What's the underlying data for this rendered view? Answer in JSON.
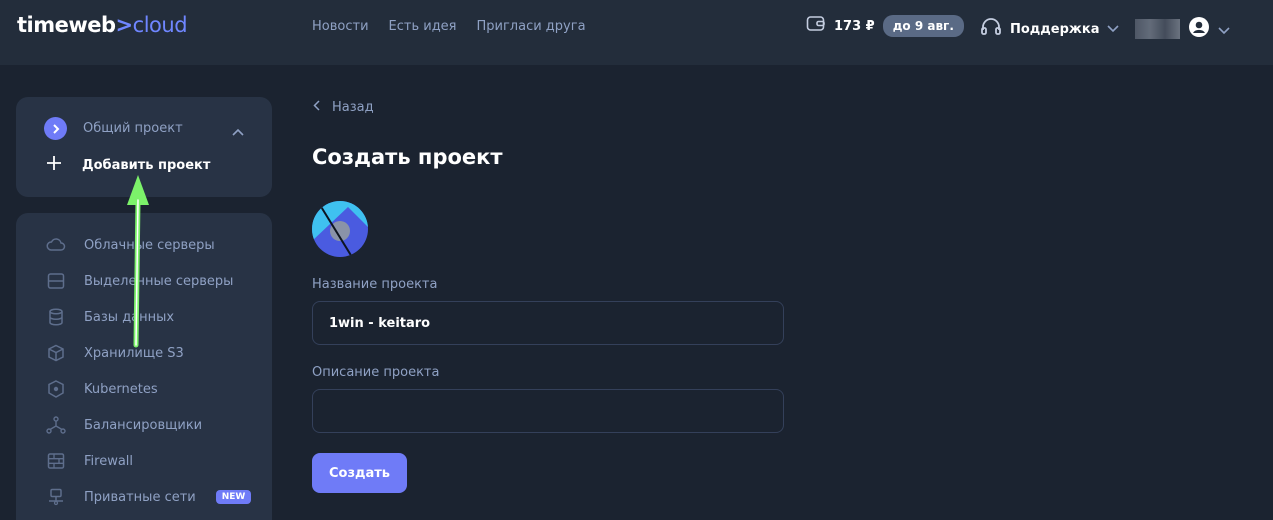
{
  "header": {
    "logo_main": "timeweb",
    "logo_chevron": ">",
    "logo_accent": "cloud",
    "nav": [
      "Новости",
      "Есть идея",
      "Пригласи друга"
    ],
    "balance": "173 ₽",
    "balance_until": "до 9 авг.",
    "support_label": "Поддержка"
  },
  "sidebar": {
    "project_name": "Общий проект",
    "add_project_label": "Добавить проект",
    "items": [
      {
        "label": "Облачные серверы",
        "icon": "cloud-icon"
      },
      {
        "label": "Выделенные серверы",
        "icon": "server-icon"
      },
      {
        "label": "Базы данных",
        "icon": "database-icon"
      },
      {
        "label": "Хранилище S3",
        "icon": "cube-icon"
      },
      {
        "label": "Kubernetes",
        "icon": "kubernetes-icon"
      },
      {
        "label": "Балансировщики",
        "icon": "balancer-icon"
      },
      {
        "label": "Firewall",
        "icon": "firewall-icon"
      },
      {
        "label": "Приватные сети",
        "icon": "network-icon",
        "badge": "NEW"
      }
    ]
  },
  "main": {
    "back_label": "Назад",
    "title": "Создать проект",
    "name_label": "Название проекта",
    "name_value": "1win - keitaro",
    "description_label": "Описание проекта",
    "description_value": "",
    "submit_label": "Создать"
  },
  "colors": {
    "background": "#1b2330",
    "header": "#232d3b",
    "panel": "#283345",
    "accent": "#6f7bf7",
    "muted_text": "#8fa1c4",
    "arrow": "#7cf26a"
  }
}
